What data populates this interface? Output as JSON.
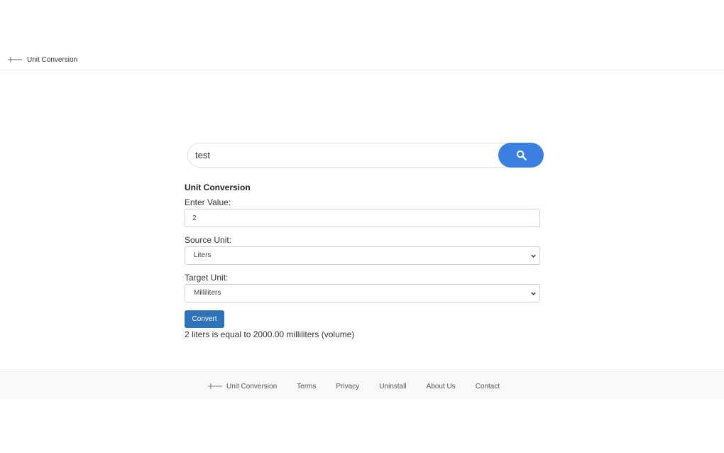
{
  "header": {
    "brand_label": "Unit Conversion",
    "logo_icon": "unit-conversion-logo-icon"
  },
  "search": {
    "value": "test",
    "button_icon": "search-icon",
    "accent_color": "#3b7fe0"
  },
  "converter": {
    "title": "Unit Conversion",
    "value_label": "Enter Value:",
    "value": "2",
    "source_label": "Source Unit:",
    "source_selected": "Liters",
    "target_label": "Target Unit:",
    "target_selected": "Milliliters",
    "convert_label": "Convert",
    "convert_color": "#2e72b8",
    "result": "2 liters is equal to 2000.00 milliliters (volume)"
  },
  "footer": {
    "brand_label": "Unit Conversion",
    "links": [
      "Terms",
      "Privacy",
      "Uninstall",
      "About Us",
      "Contact"
    ]
  }
}
